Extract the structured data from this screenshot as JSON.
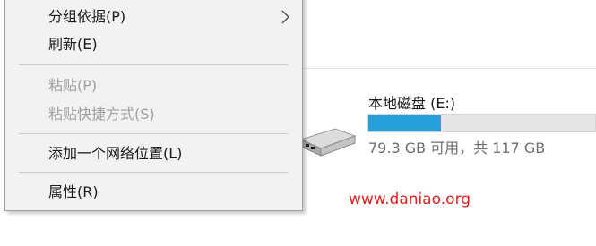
{
  "context_menu": {
    "items": [
      {
        "label": "分组依据(P)",
        "disabled": false,
        "submenu": true
      },
      {
        "label": "刷新(E)",
        "disabled": false
      },
      {
        "label": "粘贴(P)",
        "disabled": true
      },
      {
        "label": "粘贴快捷方式(S)",
        "disabled": true
      },
      {
        "label": "添加一个网络位置(L)",
        "disabled": false
      },
      {
        "label": "属性(R)",
        "disabled": false
      }
    ],
    "submenu_icon": "chevron-right-icon"
  },
  "drive": {
    "name": "本地磁盘 (E:)",
    "stats": "79.3 GB 可用，共 117 GB",
    "used_fraction": 0.32,
    "icon": "hard-drive-icon",
    "bar_color": "#26a0da"
  },
  "watermark": {
    "text": "www.daniao.org",
    "color": "#e02020"
  },
  "annotation_arrow_color": "#e02020"
}
